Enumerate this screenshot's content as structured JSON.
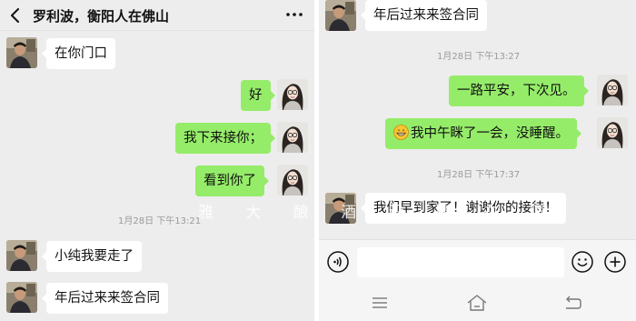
{
  "header": {
    "title": "罗利波，衡阳人在佛山"
  },
  "left_chat": {
    "messages": [
      {
        "text": "在你门口"
      },
      {
        "text": "好"
      },
      {
        "text": "我下来接你；"
      },
      {
        "text": "看到你了"
      },
      {
        "text": "小纯我要走了"
      },
      {
        "text": "年后过来来签合同"
      }
    ],
    "timestamp": "1月28日 下午13:21"
  },
  "watermark": "雅 大 酿 酒 设 备 在 国",
  "right_chat": {
    "messages": [
      {
        "text": "年后过来来签合同"
      },
      {
        "text": "一路平安，下次见。"
      },
      {
        "text": "我中午眯了一会，没睡醒。"
      },
      {
        "text": "我们早到家了！谢谢你的接待！"
      }
    ],
    "timestamps": [
      "1月28日 下午13:27",
      "1月28日 下午17:37"
    ]
  },
  "icons": {
    "back": "back-icon",
    "more": "more-icon",
    "voice": "voice-icon",
    "emoji": "emoji-icon",
    "plus": "plus-icon",
    "grin": "grin-emoji",
    "nav_menu": "menu-icon",
    "nav_home": "home-icon",
    "nav_back": "back-nav-icon"
  },
  "colors": {
    "bubble_out": "#95ec69",
    "bubble_in": "#ffffff",
    "background": "#ededed"
  }
}
